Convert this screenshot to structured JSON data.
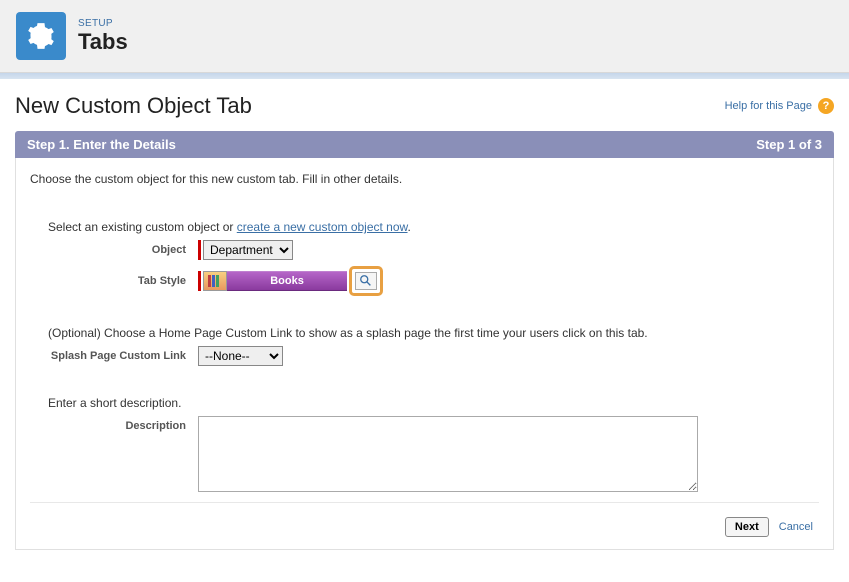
{
  "header": {
    "setup_label": "SETUP",
    "tabs_label": "Tabs"
  },
  "page_title": "New Custom Object Tab",
  "help_link": "Help for this Page",
  "step_bar": {
    "title": "Step 1. Enter the Details",
    "counter": "Step 1 of 3"
  },
  "intro": "Choose the custom object for this new custom tab. Fill in other details.",
  "fields": {
    "object_prompt_a": "Select an existing custom object or ",
    "object_prompt_link": "create a new custom object now",
    "object_prompt_b": ".",
    "object_label": "Object",
    "object_value": "Department",
    "tabstyle_label": "Tab Style",
    "tabstyle_value": "Books",
    "splash_prompt": "(Optional) Choose a Home Page Custom Link to show as a splash page the first time your users click on this tab.",
    "splash_label": "Splash Page Custom Link",
    "splash_value": "--None--",
    "desc_prompt": "Enter a short description.",
    "desc_label": "Description",
    "desc_value": ""
  },
  "footer": {
    "next": "Next",
    "cancel": "Cancel"
  }
}
